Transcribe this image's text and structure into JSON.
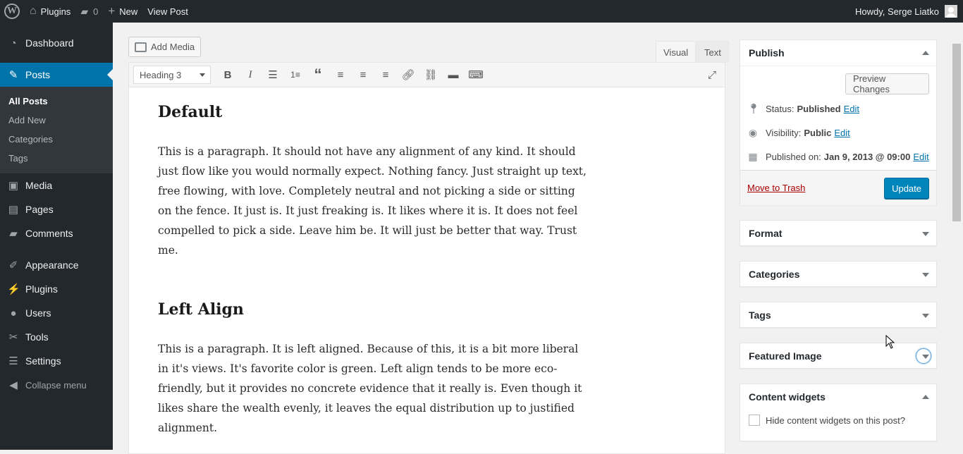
{
  "adminbar": {
    "site_name": "Plugins",
    "comments_count": "0",
    "new_label": "New",
    "view_post_label": "View Post",
    "howdy": "Howdy, Serge Liatko"
  },
  "sidebar": {
    "items": [
      {
        "label": "Dashboard",
        "icon": "dashboard-icon"
      },
      {
        "label": "Posts",
        "icon": "pin-icon"
      },
      {
        "label": "Media",
        "icon": "media-icon"
      },
      {
        "label": "Pages",
        "icon": "pages-icon"
      },
      {
        "label": "Comments",
        "icon": "comment-icon"
      },
      {
        "label": "Appearance",
        "icon": "brush-icon"
      },
      {
        "label": "Plugins",
        "icon": "plug-icon"
      },
      {
        "label": "Users",
        "icon": "user-icon"
      },
      {
        "label": "Tools",
        "icon": "wrench-icon"
      },
      {
        "label": "Settings",
        "icon": "settings-icon"
      }
    ],
    "submenu": [
      "All Posts",
      "Add New",
      "Categories",
      "Tags"
    ],
    "collapse_label": "Collapse menu"
  },
  "editor": {
    "add_media_label": "Add Media",
    "tab_visual": "Visual",
    "tab_text": "Text",
    "format_value": "Heading 3",
    "blocks": [
      {
        "heading": "Default",
        "text": "This is a paragraph. It should not have any alignment of any kind. It should just flow like you would normally expect. Nothing fancy. Just straight up text, free flowing, with love. Completely neutral and not picking a side or sitting on the fence. It just is. It just freaking is. It likes where it is. It does not feel compelled to pick a side. Leave him be. It will just be better that way. Trust me."
      },
      {
        "heading": "Left Align",
        "text": "This is a paragraph. It is left aligned. Because of this, it is a bit more liberal in it's views. It's favorite color is green. Left align tends to be more eco-friendly, but it provides no concrete evidence that it really is. Even though it likes share the wealth evenly, it leaves the equal distribution up to justified alignment."
      }
    ]
  },
  "publish": {
    "title": "Publish",
    "preview_label": "Preview Changes",
    "status_label": "Status:",
    "status_value": "Published",
    "visibility_label": "Visibility:",
    "visibility_value": "Public",
    "published_label": "Published on:",
    "published_value": "Jan 9, 2013 @ 09:00",
    "edit_label": "Edit",
    "trash_label": "Move to Trash",
    "update_label": "Update"
  },
  "boxes": {
    "format": "Format",
    "categories": "Categories",
    "tags": "Tags",
    "featured_image": "Featured Image",
    "content_widgets": "Content widgets",
    "hide_widgets_label": "Hide content widgets on this post?"
  }
}
